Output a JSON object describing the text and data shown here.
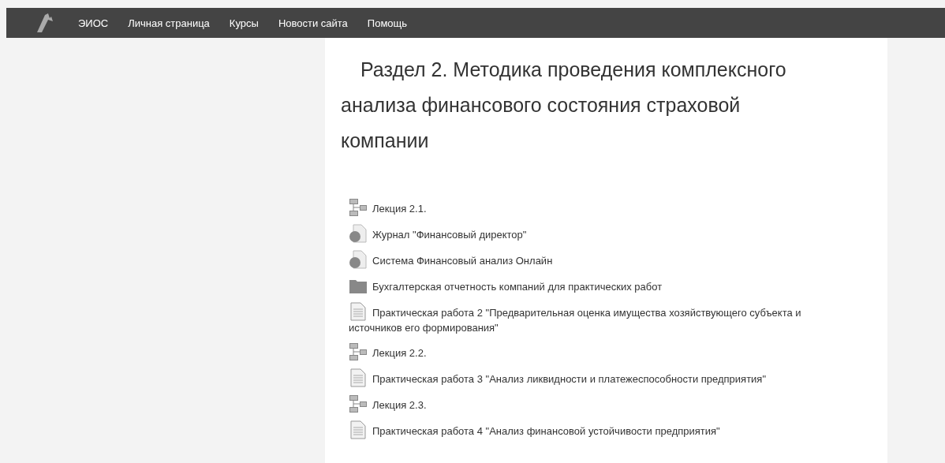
{
  "navbar": {
    "items": [
      "ЭИОС",
      "Личная страница",
      "Курсы",
      "Новости сайта",
      "Помощь"
    ]
  },
  "section": {
    "title": "Раздел 2. Методика проведения комплексного анализа финансового состояния страховой компании",
    "activities": [
      {
        "kind": "subsection",
        "label": "Лекция 2.1."
      },
      {
        "kind": "url",
        "label": "Журнал \"Финансовый директор\""
      },
      {
        "kind": "url",
        "label": "Система Финансовый анализ Онлайн"
      },
      {
        "kind": "folder",
        "label": "Бухгалтерская отчетность компаний для практических работ"
      },
      {
        "kind": "assign",
        "label": "Практическая работа 2 \"Предварительная оценка имущества хозяйствующего субъекта и источников его формирования\""
      },
      {
        "kind": "subsection",
        "label": "Лекция 2.2."
      },
      {
        "kind": "assign",
        "label": "Практическая работа 3 \"Анализ ликвидности и платежеспособности предприятия\""
      },
      {
        "kind": "subsection",
        "label": "Лекция 2.3."
      },
      {
        "kind": "assign",
        "label": "Практическая работа 4 \"Анализ финансовой устойчивости предприятия\""
      }
    ]
  }
}
